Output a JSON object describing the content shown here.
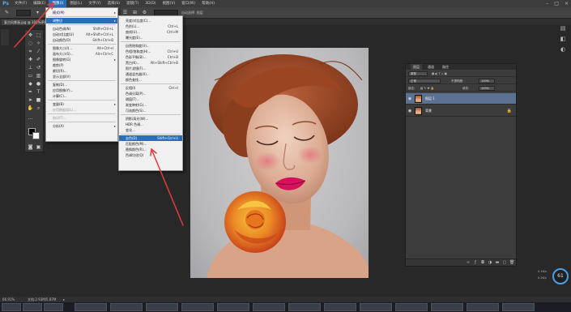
{
  "app": {
    "logo": "Ps"
  },
  "menubar": {
    "items": [
      "文件(F)",
      "编辑(E)",
      "图像(I)",
      "图层(L)",
      "文字(Y)",
      "选择(S)",
      "滤镜(T)",
      "3D(D)",
      "视图(V)",
      "窗口(W)",
      "帮助(H)"
    ],
    "active_index": 2
  },
  "window_controls": {
    "minimize": "–",
    "restore": "□",
    "close": "×"
  },
  "options_bar": {
    "auto_align": "自动选择: 图层"
  },
  "document": {
    "tab": "复古风景画.jpg @ 100%(RGB/8)"
  },
  "image_menu": {
    "items": [
      {
        "label": "模式(M)",
        "shortcut": "",
        "submenu": true,
        "dim": false,
        "sep_after": true
      },
      {
        "label": "调整(J)",
        "shortcut": "",
        "submenu": true,
        "dim": false,
        "highlight": true,
        "sep_after": true
      },
      {
        "label": "自动色调(N)",
        "shortcut": "Shift+Ctrl+L",
        "dim": false
      },
      {
        "label": "自动对比度(U)",
        "shortcut": "Alt+Shift+Ctrl+L",
        "dim": false
      },
      {
        "label": "自动颜色(O)",
        "shortcut": "Shift+Ctrl+B",
        "dim": false,
        "sep_after": true
      },
      {
        "label": "图像大小(I)...",
        "shortcut": "Alt+Ctrl+I",
        "dim": false
      },
      {
        "label": "画布大小(S)...",
        "shortcut": "Alt+Ctrl+C",
        "dim": false
      },
      {
        "label": "图像旋转(G)",
        "shortcut": "",
        "submenu": true,
        "dim": false
      },
      {
        "label": "裁剪(P)",
        "shortcut": "",
        "dim": false
      },
      {
        "label": "裁切(R)...",
        "shortcut": "",
        "dim": false
      },
      {
        "label": "显示全部(V)",
        "shortcut": "",
        "dim": false,
        "sep_after": true
      },
      {
        "label": "复制(D)...",
        "shortcut": "",
        "dim": false
      },
      {
        "label": "应用图像(Y)...",
        "shortcut": "",
        "dim": false
      },
      {
        "label": "计算(C)...",
        "shortcut": "",
        "dim": false,
        "sep_after": true
      },
      {
        "label": "变量(B)",
        "shortcut": "",
        "submenu": true,
        "dim": false
      },
      {
        "label": "应用数据组(L)...",
        "shortcut": "",
        "dim": true,
        "sep_after": true
      },
      {
        "label": "陷印(T)...",
        "shortcut": "",
        "dim": true,
        "sep_after": true
      },
      {
        "label": "分析(A)",
        "shortcut": "",
        "submenu": true,
        "dim": false
      }
    ]
  },
  "adjust_menu": {
    "items": [
      {
        "label": "亮度/对比度(C)...",
        "shortcut": ""
      },
      {
        "label": "色阶(L)...",
        "shortcut": "Ctrl+L"
      },
      {
        "label": "曲线(U)...",
        "shortcut": "Ctrl+M"
      },
      {
        "label": "曝光度(E)...",
        "shortcut": "",
        "sep_after": true
      },
      {
        "label": "自然饱和度(V)...",
        "shortcut": ""
      },
      {
        "label": "色相/饱和度(H)...",
        "shortcut": "Ctrl+U"
      },
      {
        "label": "色彩平衡(B)...",
        "shortcut": "Ctrl+B"
      },
      {
        "label": "黑白(K)...",
        "shortcut": "Alt+Shift+Ctrl+B"
      },
      {
        "label": "照片滤镜(F)...",
        "shortcut": ""
      },
      {
        "label": "通道混合器(X)...",
        "shortcut": ""
      },
      {
        "label": "颜色查找...",
        "shortcut": "",
        "sep_after": true
      },
      {
        "label": "反相(I)",
        "shortcut": "Ctrl+I"
      },
      {
        "label": "色调分离(P)...",
        "shortcut": ""
      },
      {
        "label": "阈值(T)...",
        "shortcut": ""
      },
      {
        "label": "渐变映射(G)...",
        "shortcut": ""
      },
      {
        "label": "可选颜色(S)...",
        "shortcut": "",
        "sep_after": true
      },
      {
        "label": "阴影/高光(W)...",
        "shortcut": ""
      },
      {
        "label": "HDR 色调...",
        "shortcut": ""
      },
      {
        "label": "变化...",
        "shortcut": "",
        "sep_after": true
      },
      {
        "label": "去色(D)",
        "shortcut": "Shift+Ctrl+U",
        "highlight": true
      },
      {
        "label": "匹配颜色(M)...",
        "shortcut": ""
      },
      {
        "label": "替换颜色(R)...",
        "shortcut": ""
      },
      {
        "label": "色调均化(Q)",
        "shortcut": ""
      }
    ]
  },
  "layers_panel": {
    "tabs": [
      "图层",
      "通道",
      "路径"
    ],
    "filter_label": "类型",
    "blend_mode": "正常",
    "opacity_label": "不透明度:",
    "opacity_value": "100%",
    "lock_label": "锁定:",
    "fill_label": "填充:",
    "fill_value": "100%",
    "layers": [
      {
        "name": "图层 1",
        "selected": true,
        "locked": false
      },
      {
        "name": "背景",
        "selected": false,
        "locked": true
      }
    ]
  },
  "status": {
    "zoom": "66.91%",
    "doc_info": "文档:2.93M/5.87M"
  },
  "perf": {
    "percent": "61",
    "stat1": "0.1K/s",
    "stat2": "0.2K/s"
  },
  "accent_colors": {
    "menu_highlight": "#2d6db6",
    "layer_selected": "#5a7191",
    "annotation_arrow": "#e23b3b"
  }
}
